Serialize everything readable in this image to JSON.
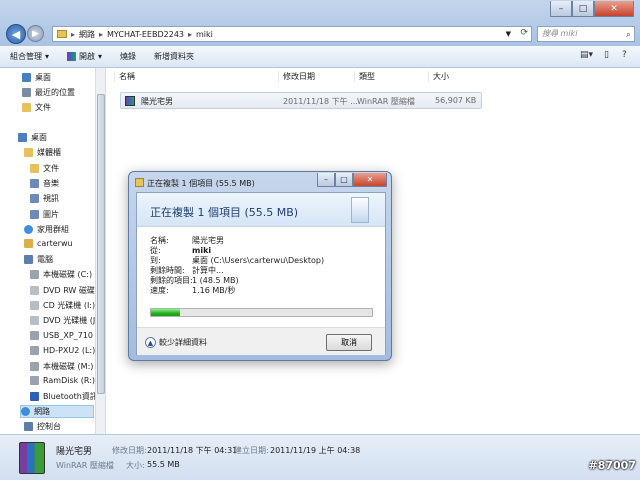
{
  "address": {
    "crumbs": [
      "網路",
      "MYCHAT-EEBD2243",
      "miki"
    ]
  },
  "search": {
    "placeholder": "搜尋 miki"
  },
  "toolbar": {
    "organize": "組合管理",
    "open": "開啟",
    "burn": "燒錄",
    "new_folder": "新增資料夾"
  },
  "nav": {
    "favorites": [
      "桌面",
      "最近的位置",
      "文件"
    ],
    "desktop": "桌面",
    "libraries": "媒體櫃",
    "library_items": [
      "文件",
      "音樂",
      "視訊",
      "圖片"
    ],
    "homegroup": "家用群組",
    "user": "carterwu",
    "computer": "電腦",
    "drives": [
      "本機磁碟 (C:)",
      "DVD RW 磁碟機",
      "CD 光碟機 (I:) U",
      "DVD 光碟機 (J:)",
      "USB_XP_710 (K",
      "HD-PXU2 (L:)",
      "本機磁碟 (M:)",
      "RamDisk (R:)",
      "Bluetooth資訊交"
    ],
    "network": "網路",
    "control_panel": "控制台"
  },
  "columns": {
    "name": "名稱",
    "modified": "修改日期",
    "type": "類型",
    "size": "大小"
  },
  "file": {
    "name": "陽光宅男",
    "modified": "2011/11/18 下午 ...",
    "type": "WinRAR 壓縮檔",
    "size": "56,907 KB"
  },
  "dialog": {
    "title": "正在複製 1 個項目 (55.5 MB)",
    "heading": "正在複製 1 個項目 (55.5 MB)",
    "name_label": "名稱:",
    "name_value": "陽光宅男",
    "from_label": "從:",
    "from_value": "miki",
    "to_label": "到:",
    "to_value": "桌面 (C:\\Users\\carterwu\\Desktop)",
    "time_label": "剩餘時間:",
    "time_value": "計算中...",
    "items_label": "剩餘的項目:",
    "items_value": "1 (48.5 MB)",
    "speed_label": "速度:",
    "speed_value": "1.16 MB/秒",
    "progress_fraction": 0.13,
    "less_details": "較少詳細資料",
    "cancel": "取消"
  },
  "status": {
    "name": "陽光宅男",
    "type": "WinRAR 壓縮檔",
    "modified_label": "修改日期:",
    "modified_value": "2011/11/18 下午 04:31",
    "created_label": "建立日期:",
    "created_value": "2011/11/19 上午 04:38",
    "size_label": "大小:",
    "size_value": "55.5 MB"
  },
  "watermark": "#87007"
}
